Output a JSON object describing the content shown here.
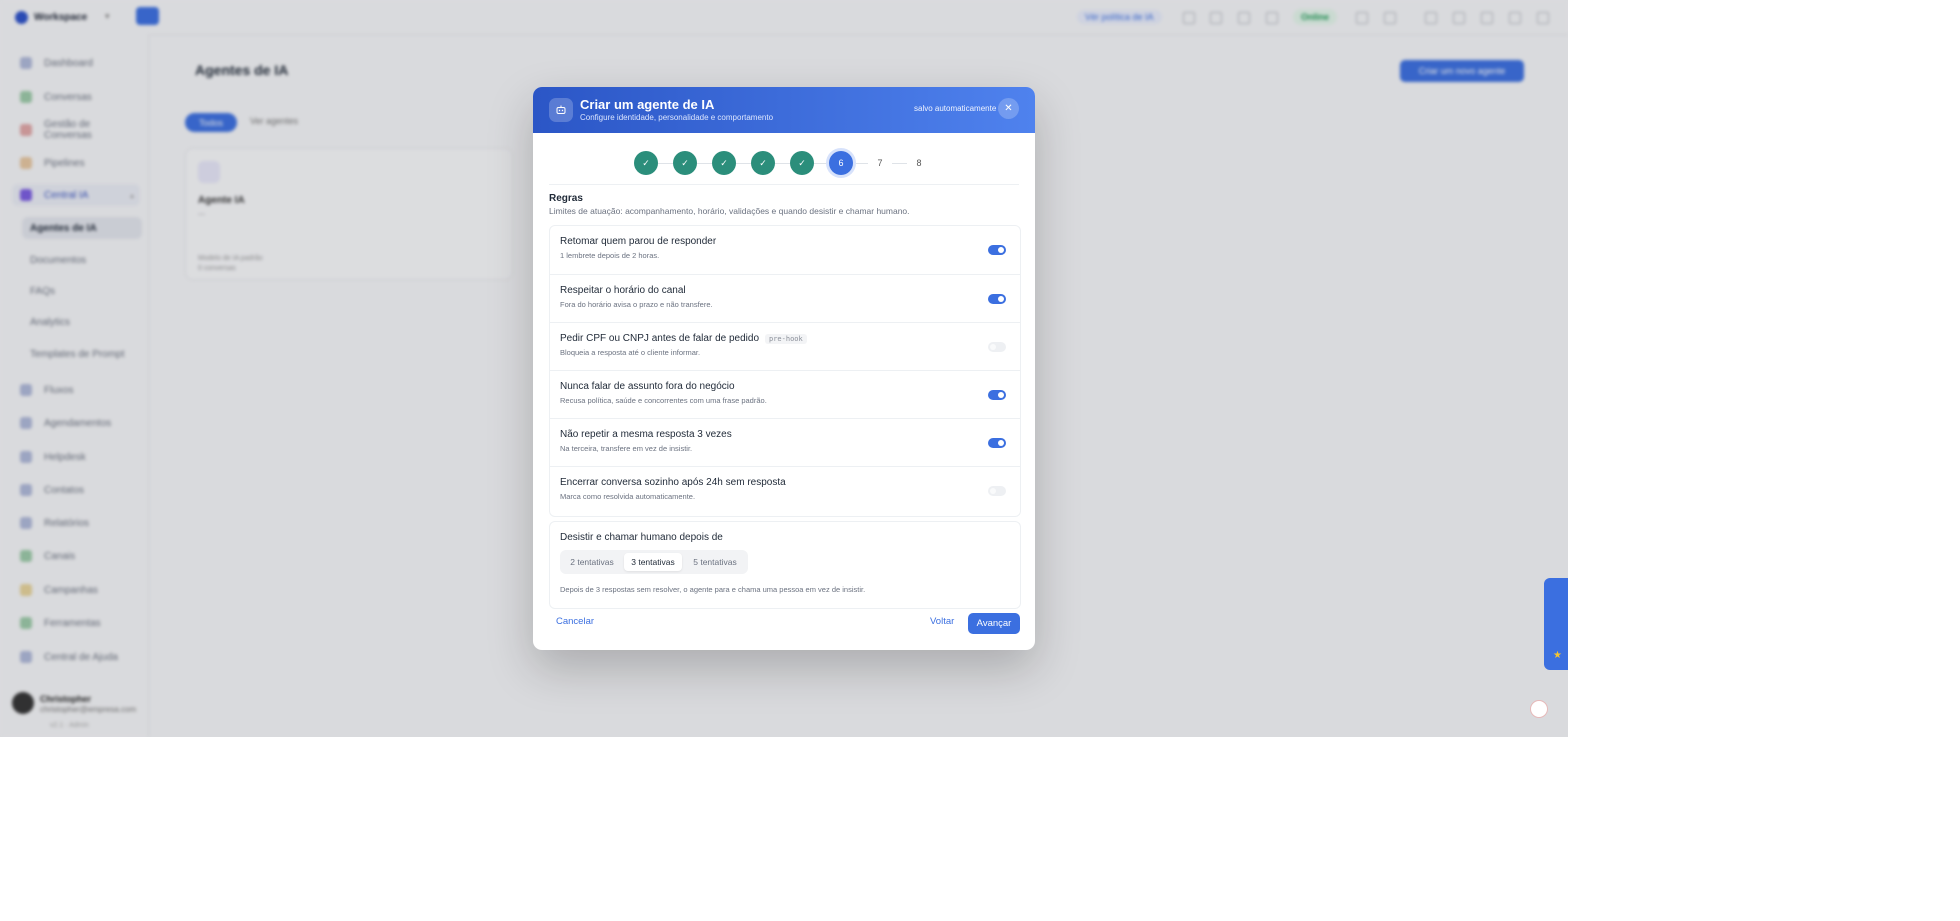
{
  "workspace": {
    "name": "Workspace"
  },
  "topbar": {
    "ia_pill": "Vér política de IA",
    "status": "Online"
  },
  "sidebar": {
    "items": [
      {
        "label": "Dashboard"
      },
      {
        "label": "Conversas"
      },
      {
        "label": "Gestão de Conversas"
      },
      {
        "label": "Pipelines"
      },
      {
        "label": "Central IA"
      },
      {
        "label": "Fluxos"
      },
      {
        "label": "Agendamentos"
      },
      {
        "label": "Helpdesk"
      },
      {
        "label": "Contatos"
      },
      {
        "label": "Relatórios"
      },
      {
        "label": "Canais"
      },
      {
        "label": "Campanhas"
      },
      {
        "label": "Ferramentas"
      },
      {
        "label": "Central de Ajuda"
      }
    ],
    "sub_items": [
      {
        "label": "Agentes de IA"
      },
      {
        "label": "Documentos"
      },
      {
        "label": "FAQs"
      },
      {
        "label": "Analytics"
      },
      {
        "label": "Templates de Prompt"
      }
    ],
    "user": {
      "name": "Christopher",
      "email": "christopher@empresa.com",
      "version": "v2.1 · Admin"
    }
  },
  "main": {
    "title": "Agentes de IA",
    "create_label": "Criar um novo agente",
    "tab_active": "Todos",
    "tab_other": "Ver agentes",
    "card": {
      "title": "Agente IA",
      "subtitle": "—",
      "meta1": "Modelo de IA padrão",
      "meta2": "0 conversas"
    }
  },
  "modal": {
    "title": "Criar um agente de IA",
    "subtitle": "Configure identidade, personalidade e comportamento",
    "saved": "salvo automaticamente",
    "close_glyph": "✕",
    "steps": [
      {
        "label": "✓",
        "state": "done"
      },
      {
        "label": "✓",
        "state": "done"
      },
      {
        "label": "✓",
        "state": "done"
      },
      {
        "label": "✓",
        "state": "done"
      },
      {
        "label": "✓",
        "state": "done"
      },
      {
        "label": "6",
        "state": "current"
      },
      {
        "label": "7",
        "state": "todo"
      },
      {
        "label": "8",
        "state": "todo"
      }
    ],
    "section_title": "Regras",
    "section_desc": "Limites de atuação: acompanhamento, horário, validações e quando desistir e chamar humano.",
    "rules": [
      {
        "title": "Retomar quem parou de responder",
        "desc": "1 lembrete depois de 2 horas.",
        "tag": "",
        "on": true
      },
      {
        "title": "Respeitar o horário do canal",
        "desc": "Fora do horário avisa o prazo e não transfere.",
        "tag": "",
        "on": true
      },
      {
        "title": "Pedir CPF ou CNPJ antes de falar de pedido",
        "desc": "Bloqueia a resposta até o cliente informar.",
        "tag": "pre-hook",
        "on": false
      },
      {
        "title": "Nunca falar de assunto fora do negócio",
        "desc": "Recusa política, saúde e concorrentes com uma frase padrão.",
        "tag": "",
        "on": true
      },
      {
        "title": "Não repetir a mesma resposta 3 vezes",
        "desc": "Na terceira, transfere em vez de insistir.",
        "tag": "",
        "on": true
      },
      {
        "title": "Encerrar conversa sozinho após 24h sem resposta",
        "desc": "Marca como resolvida automaticamente.",
        "tag": "",
        "on": false
      }
    ],
    "giveup": {
      "title": "Desistir e chamar humano depois de",
      "options": [
        "2 tentativas",
        "3 tentativas",
        "5 tentativas"
      ],
      "selected": "3 tentativas",
      "desc": "Depois de 3 respostas sem resolver, o agente para e chama uma pessoa em vez de insistir."
    },
    "footer": {
      "cancel": "Cancelar",
      "back": "Voltar",
      "next": "Avançar"
    }
  }
}
